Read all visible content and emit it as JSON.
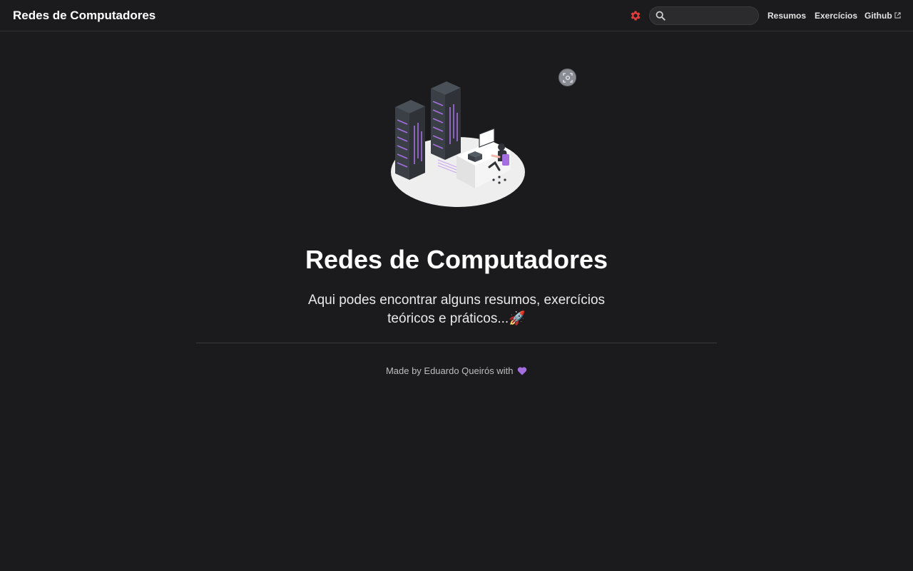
{
  "navbar": {
    "brand": "Redes de Computadores",
    "search": {
      "placeholder": "",
      "value": ""
    },
    "links": {
      "resumos": "Resumos",
      "exercicios": "Exercícios",
      "github": "Github"
    },
    "icons": {
      "settings": "gear-icon",
      "search": "search-icon",
      "external": "external-link-icon"
    },
    "colors": {
      "settings_icon": "#e03c3c"
    }
  },
  "hero": {
    "title": "Redes de Computadores",
    "subtitle": "Aqui podes encontrar alguns resumos, exercícios teóricos e práticos...🚀"
  },
  "footer": {
    "text": "Made by Eduardo Queirós with",
    "emoji": "purple-heart"
  },
  "colors": {
    "background": "#1b1b1d",
    "accent": "#a56ee0"
  }
}
